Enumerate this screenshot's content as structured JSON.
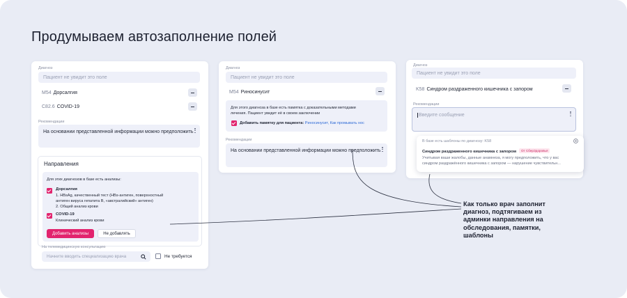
{
  "page": {
    "title": "Продумываем автозаполнение полей"
  },
  "panel1": {
    "diagnosis_label": "Диагноз",
    "diagnosis_placeholder": "Пациент не увидит это поле",
    "diagnoses": [
      {
        "code": "M54",
        "name": "Дорсалгия"
      },
      {
        "code": "C82.6",
        "name": "COVID-19"
      }
    ],
    "recommendations_label": "Рекомендации",
    "recommendations_text": "На основании представленной информации можно предположить",
    "referrals": {
      "title": "Направления",
      "intro": "Для этих диагнозов в базе есть анализы:",
      "items": [
        {
          "name": "Дорсалгия",
          "line1": "1. HBsAg, качественный тест (HBs-антиген, поверхностный",
          "line2": "антиген вируса гепатита B, «австралийский» антиген)",
          "line3": "2. Общий анализ крови"
        },
        {
          "name": "COVID-19",
          "line1": "Клинический анализ крови"
        }
      ],
      "add_button": "Добавить анализы",
      "skip_button": "Не добавлять"
    },
    "teleconsult_label": "На телемедицинскую консультацию",
    "teleconsult_placeholder": "Начните вводить специализацию врача",
    "not_required": "Не требуется"
  },
  "panel2": {
    "diagnosis_label": "Диагноз",
    "diagnosis_placeholder": "Пациент не увидит это поле",
    "diagnosis": {
      "code": "M54",
      "name": "Риносинусит"
    },
    "memo_text_1": "Для этого диагноза в базе есть памятка с доказательными методами",
    "memo_text_2": "лечения. Пациент увидит её в своем заключении",
    "memo_check_label": "Добавить памятку для пациента:",
    "memo_links": "Риносинусит, Как промывать нос",
    "recommendations_label": "Рекомендации",
    "recommendations_text": "На основании представленной информации можно предположить"
  },
  "panel3": {
    "diagnosis_label": "Диагноз",
    "diagnosis_placeholder": "Пациент не увидит это поле",
    "diagnosis": {
      "code": "K58",
      "name": "Синдром раздраженного кишечника с запором"
    },
    "recommendations_label": "Рекомендации",
    "message_placeholder": "Введите сообщение",
    "template_popup": {
      "header": "В базе есть шаблоны по диагнозу: K58",
      "title": "Синдром раздраженного кишечника с запором",
      "tag": "От СберЗдоровья",
      "line1": "Учитывая ваши жалобы, данные анамнеза, я могу предположить, что у вас",
      "line2": "синдром раздражённого кишечника с запором — нарушение чувствительн..."
    }
  },
  "annotation": "Как только врач заполнит диагноз, подтягиваем из админки направления на обследования, памятки, шаблоны"
}
